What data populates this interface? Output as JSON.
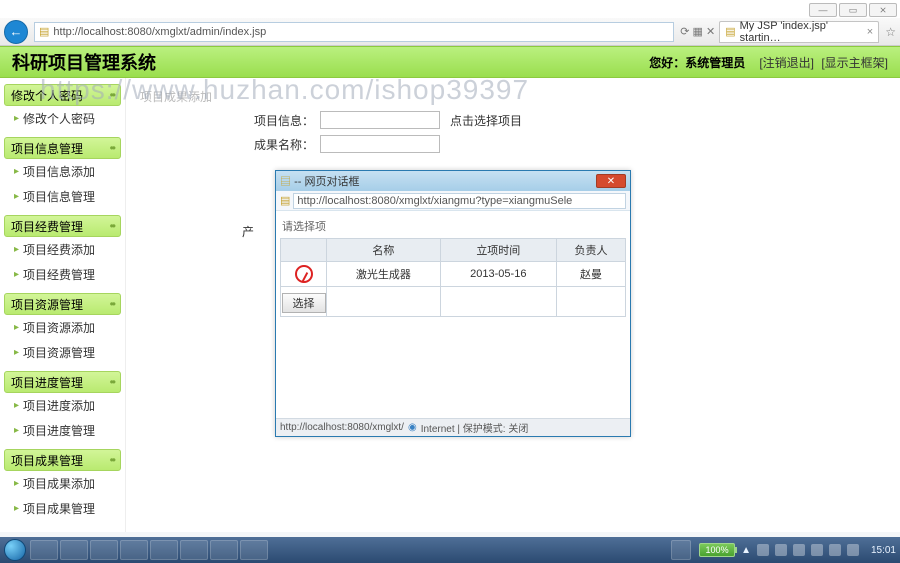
{
  "window": {
    "min": "—",
    "max": "▭",
    "close": "⨯"
  },
  "browser": {
    "back": "←",
    "url": "http://localhost:8080/xmglxt/admin/index.jsp",
    "refresh_icons": "⟳ ▦ ✕",
    "tab_title": "My JSP 'index.jsp' startin…",
    "star": "☆"
  },
  "header": {
    "title": "科研项目管理系统",
    "hello": "您好：系统管理员",
    "logout": "[注销退出]",
    "show_frame": "[显示主框架]"
  },
  "sidebar": {
    "groups": [
      {
        "title": "修改个人密码",
        "items": [
          "修改个人密码"
        ]
      },
      {
        "title": "项目信息管理",
        "items": [
          "项目信息添加",
          "项目信息管理"
        ]
      },
      {
        "title": "项目经费管理",
        "items": [
          "项目经费添加",
          "项目经费管理"
        ]
      },
      {
        "title": "项目资源管理",
        "items": [
          "项目资源添加",
          "项目资源管理"
        ]
      },
      {
        "title": "项目进度管理",
        "items": [
          "项目进度添加",
          "项目进度管理"
        ]
      },
      {
        "title": "项目成果管理",
        "items": [
          "项目成果添加",
          "项目成果管理"
        ]
      }
    ]
  },
  "content": {
    "tab": "项目成果添加",
    "field1_label": "项目信息：",
    "field1_hint": "点击选择项目",
    "field2_label": "成果名称：",
    "field3_label": "产"
  },
  "dialog": {
    "title_prefix": "-- 网页对话框",
    "url": "http://localhost:8080/xmglxt/xiangmu?type=xiangmuSele",
    "select_label": "请选择项",
    "cols": [
      "",
      "名称",
      "立项时间",
      "负责人"
    ],
    "row": {
      "name": "激光生成器",
      "date": "2013-05-16",
      "owner": "赵曼"
    },
    "select_btn": "选择",
    "status_url": "http://localhost:8080/xmglxt/",
    "status_zone": "Internet | 保护模式: 关闭"
  },
  "taskbar": {
    "battery": "100%",
    "time": "15:01",
    "tray_up": "▲"
  },
  "watermark": "https://www.huzhan.com/ishop39397"
}
